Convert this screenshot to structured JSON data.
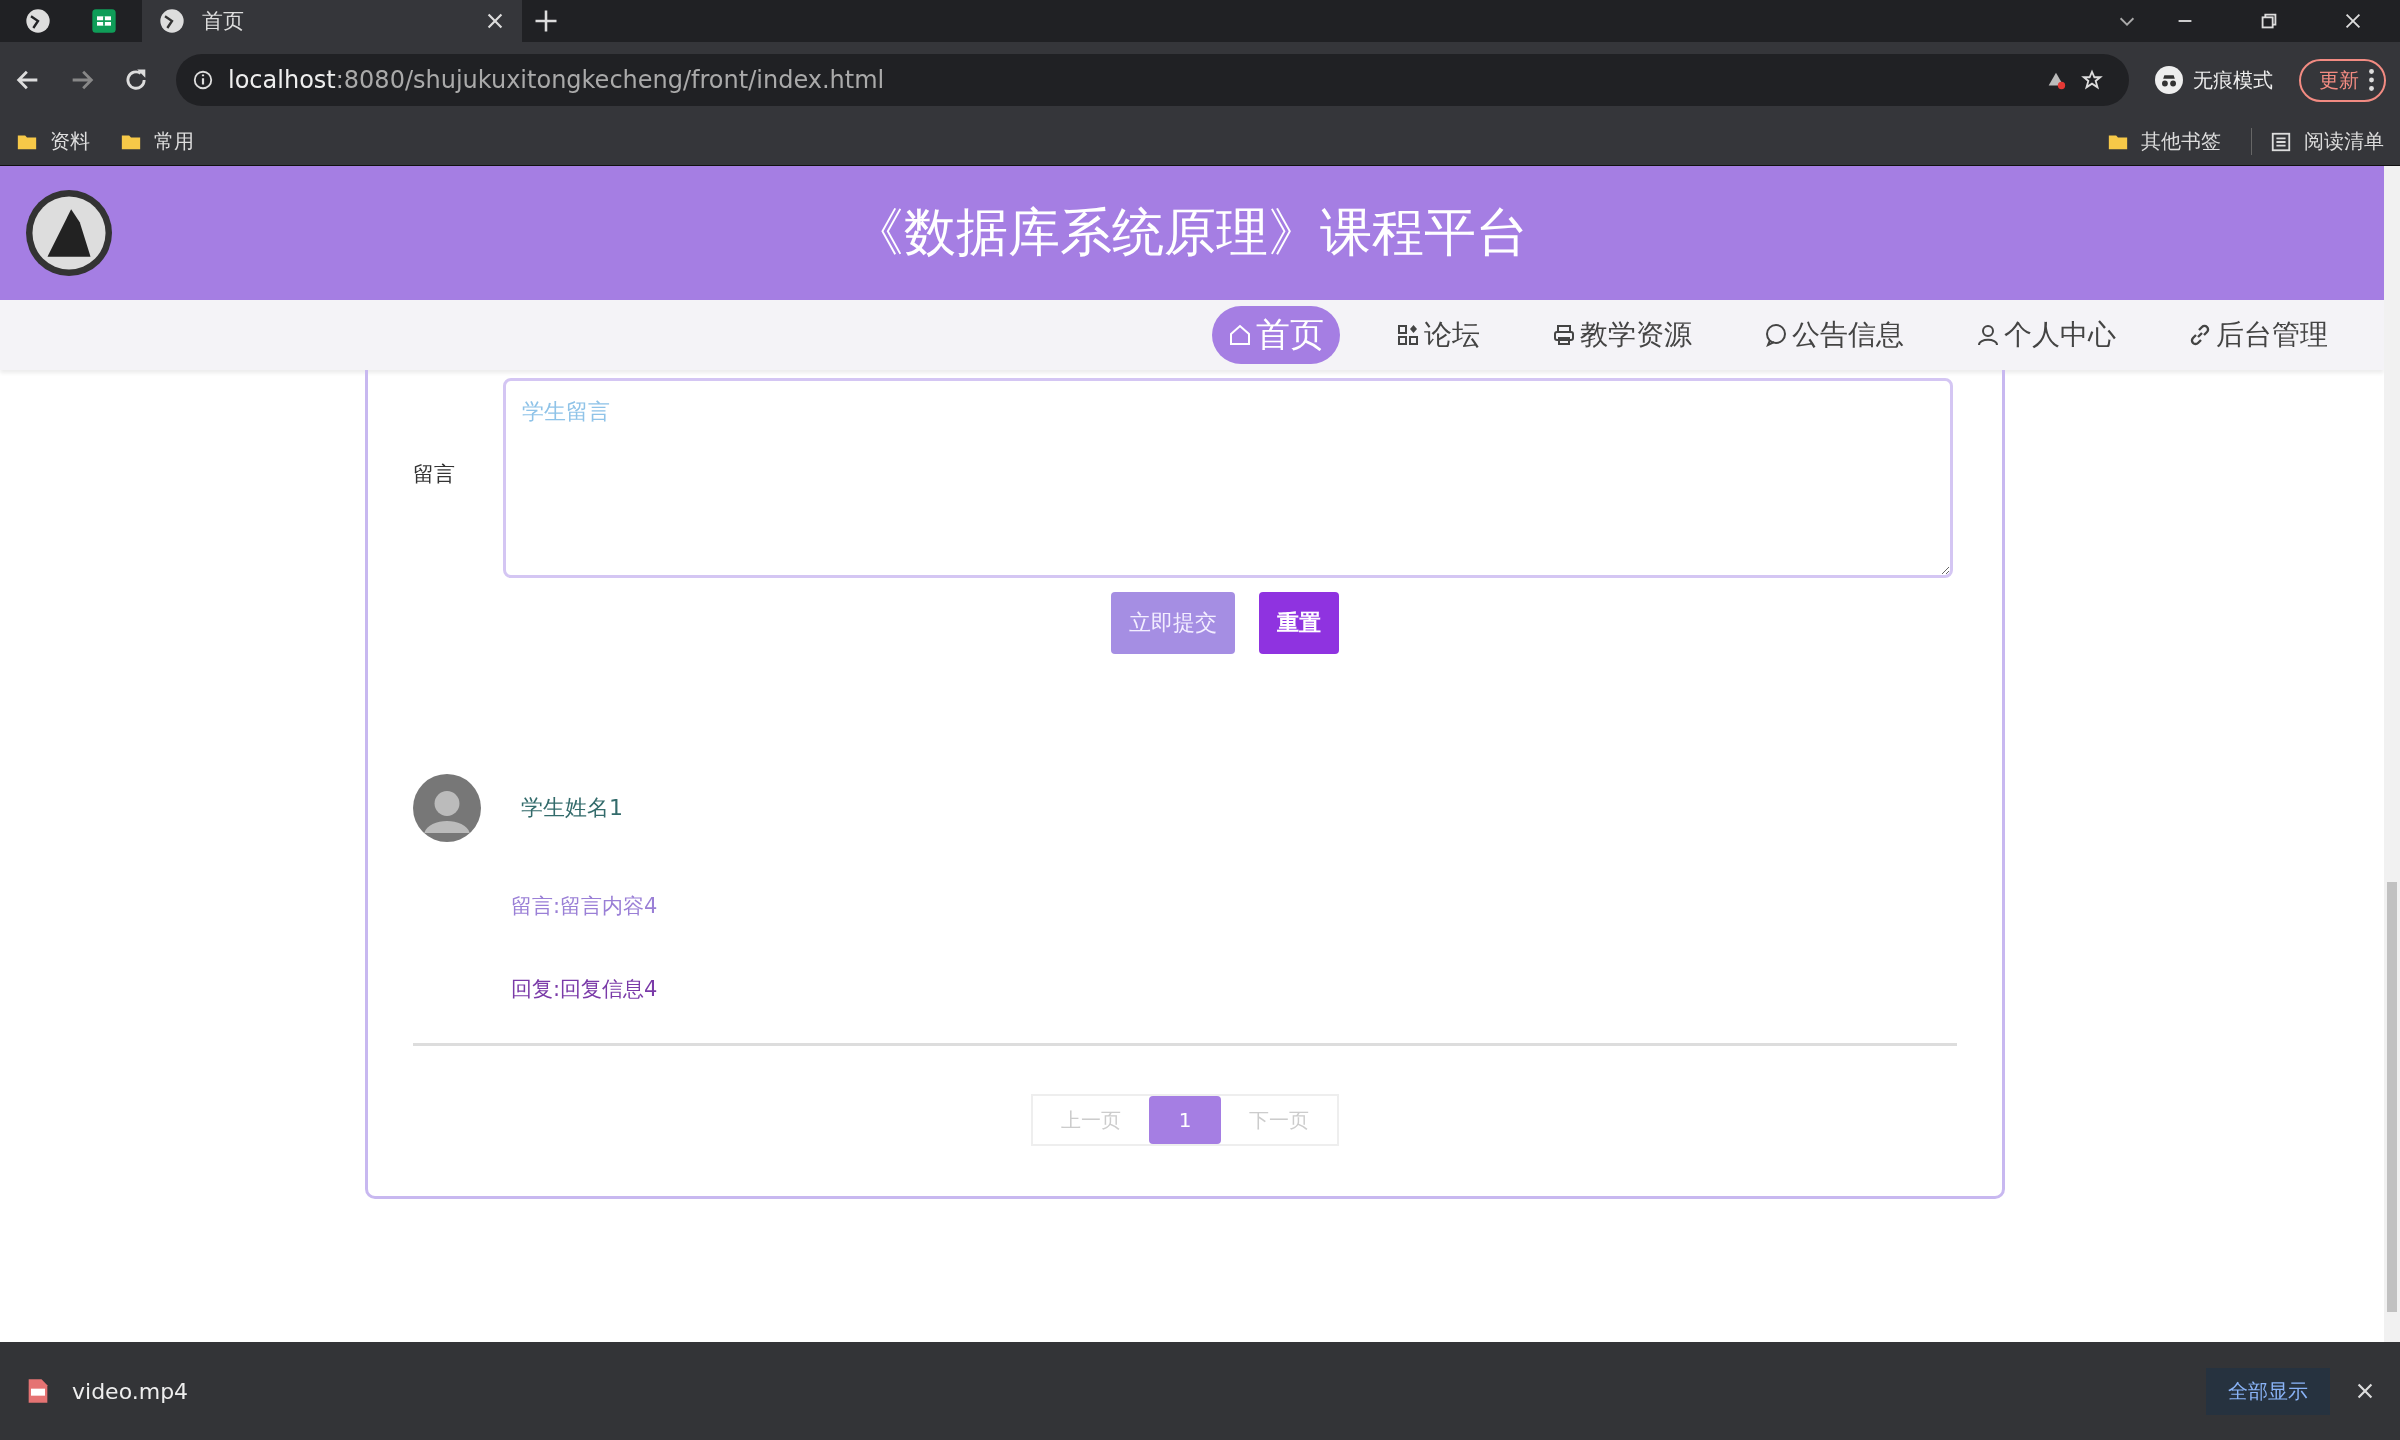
{
  "browser": {
    "tabs": [
      {
        "title": "首页",
        "selected": true
      }
    ],
    "address_host": "localhost",
    "address_rest": ":8080/shujukuxitongkecheng/front/index.html",
    "incognito_label": "无痕模式",
    "update_button": "更新",
    "bookmarks": [
      "资料",
      "常用"
    ],
    "other_bookmarks": "其他书签",
    "reading_list": "阅读清单"
  },
  "header": {
    "title": "《数据库系统原理》课程平台"
  },
  "nav": [
    {
      "label": "首页",
      "kind": "home",
      "selected": true
    },
    {
      "label": "论坛",
      "kind": "forum",
      "selected": false
    },
    {
      "label": "教学资源",
      "kind": "resources",
      "selected": false
    },
    {
      "label": "公告信息",
      "kind": "notices",
      "selected": false
    },
    {
      "label": "个人中心",
      "kind": "profile",
      "selected": false
    },
    {
      "label": "后台管理",
      "kind": "admin",
      "selected": false
    }
  ],
  "form": {
    "label": "留言",
    "placeholder": "学生留言",
    "submit_button": "立即提交",
    "reset_button": "重置"
  },
  "comments": [
    {
      "name": "学生姓名1",
      "message": "留言:留言内容4",
      "reply": "回复:回复信息4"
    }
  ],
  "pagination": {
    "prev": "上一页",
    "pages": [
      {
        "label": "1",
        "selected": true
      }
    ],
    "next": "下一页"
  },
  "downloads": {
    "file": "video.mp4",
    "show_all": "全部显示"
  }
}
